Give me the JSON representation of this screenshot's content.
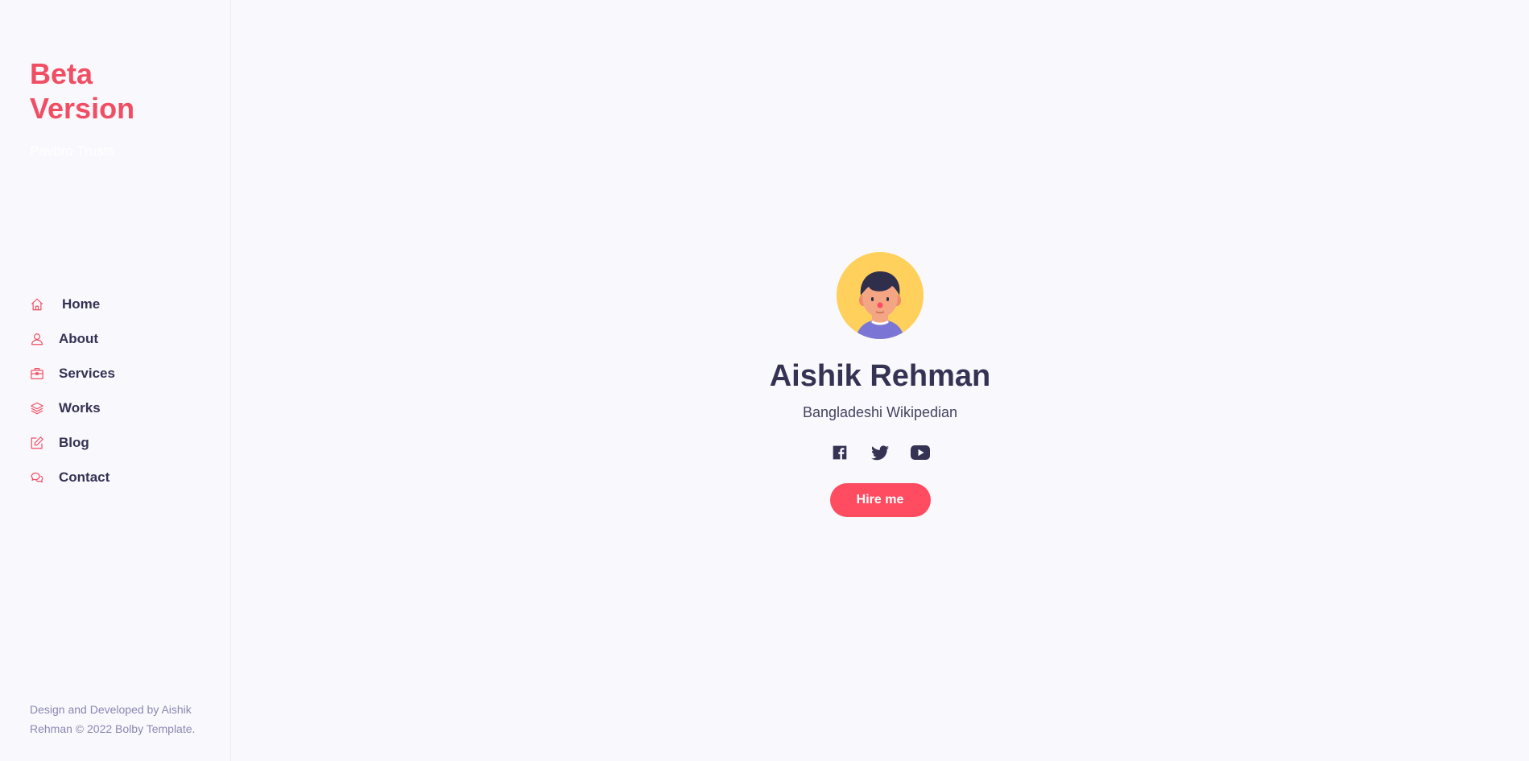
{
  "brand": {
    "title": "Beta Version",
    "tagline": "Pavbro Trusts"
  },
  "nav": [
    {
      "label": "Home",
      "icon": "home-icon"
    },
    {
      "label": "About",
      "icon": "user-icon"
    },
    {
      "label": "Services",
      "icon": "briefcase-icon"
    },
    {
      "label": "Works",
      "icon": "layers-icon"
    },
    {
      "label": "Blog",
      "icon": "note-icon"
    },
    {
      "label": "Contact",
      "icon": "bubbles-icon"
    }
  ],
  "footer": {
    "text": "Design and Developed by Aishik Rehman © 2022 Bolby Template."
  },
  "hero": {
    "name": "Aishik Rehman",
    "role": "Bangladeshi Wikipedian",
    "button_label": "Hire me",
    "social": [
      "facebook-icon",
      "twitter-icon",
      "youtube-icon"
    ]
  },
  "colors": {
    "accent": "#ff4c60",
    "text": "#353353",
    "background": "#f9f8fd",
    "avatar_bg": "#ffd15c"
  }
}
